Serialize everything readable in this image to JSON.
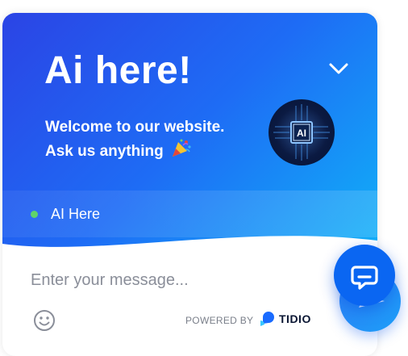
{
  "header": {
    "title": "Ai here!",
    "welcome_line1": "Welcome to our website.",
    "welcome_line2": "Ask us anything",
    "avatar_badge": "AI"
  },
  "status": {
    "label": "AI Here",
    "dot_color": "#5fd46a"
  },
  "composer": {
    "placeholder": "Enter your message...",
    "value": ""
  },
  "footer": {
    "powered_by": "POWERED BY",
    "brand": "TIDIO"
  },
  "icons": {
    "collapse": "chevron-down-icon",
    "emoji": "smiley-icon",
    "party": "party-popper-icon",
    "send": "send-icon",
    "launcher": "chat-bubble-icon"
  },
  "colors": {
    "gradient_start": "#2b44e5",
    "gradient_end": "#10b2f8",
    "launcher": "#0a66f2"
  }
}
